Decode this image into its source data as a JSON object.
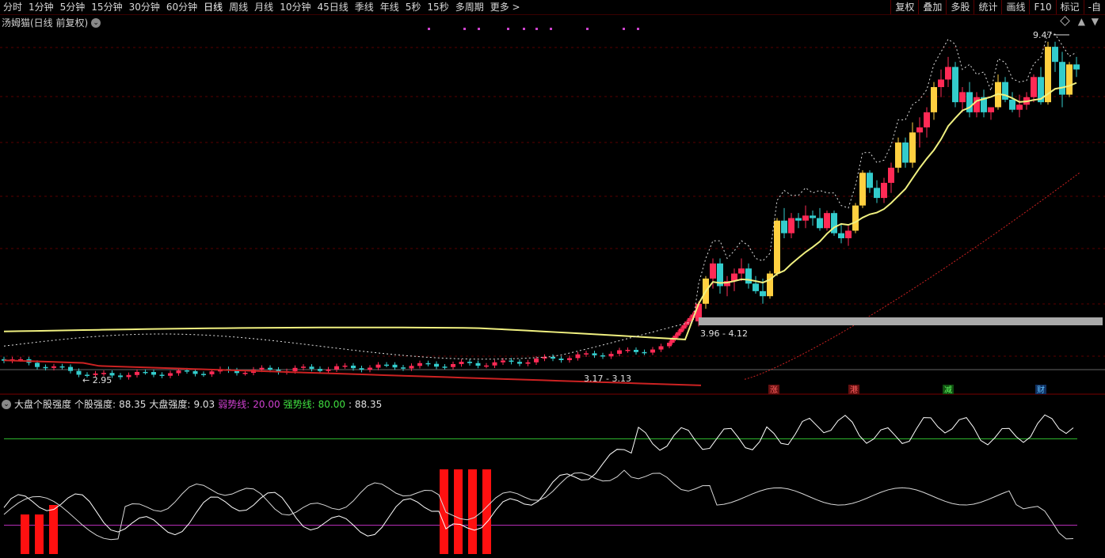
{
  "toolbar": {
    "periods": [
      "分时",
      "1分钟",
      "5分钟",
      "15分钟",
      "30分钟",
      "60分钟",
      "日线",
      "周线",
      "月线",
      "10分钟",
      "45日线",
      "季线",
      "年线",
      "5秒",
      "15秒",
      "多周期",
      "更多 >"
    ],
    "active_index": 6,
    "right_buttons": [
      "复权",
      "叠加",
      "多股",
      "统计",
      "画线",
      "F10",
      "标记",
      "-自"
    ]
  },
  "main_title": "汤姆猫(日线 前复权)",
  "price_labels": {
    "high": "9.47",
    "low_left": "2.95",
    "range_mid": "3.96 - 4.12",
    "range_low": "3.17 - 3.13"
  },
  "event_markers": [
    "涨",
    "港",
    "减",
    "财"
  ],
  "indicator": {
    "name": "大盘个股强度",
    "stock_label": "个股强度:",
    "stock_value": "88.35",
    "market_label": "大盘强度:",
    "market_value": "9.03",
    "weak_label": "弱势线:",
    "weak_value": "20.00",
    "strong_label": "强势线:",
    "strong_value": "80.00",
    "extra_value": ": 88.35"
  },
  "colors": {
    "up": "#ff2a55",
    "down": "#33cccc",
    "ma_yellow": "#f0f080",
    "dotted_white": "#e0e0e0",
    "red_line": "#cc2222",
    "grid": "#5a0000",
    "strong_line": "#30c030",
    "weak_line": "#c030c0",
    "signal_purple": "#cc44cc"
  },
  "chart_data": {
    "type": "candlestick",
    "price_range": [
      2.7,
      9.8
    ],
    "candles_late": [
      [
        4.05,
        4.45,
        3.95,
        4.4
      ],
      [
        4.4,
        4.95,
        4.3,
        4.9
      ],
      [
        4.9,
        5.3,
        4.7,
        5.2
      ],
      [
        5.2,
        5.3,
        4.6,
        4.75
      ],
      [
        4.75,
        4.95,
        4.55,
        4.85
      ],
      [
        4.85,
        5.1,
        4.65,
        5.0
      ],
      [
        5.0,
        5.3,
        4.85,
        5.1
      ],
      [
        5.1,
        5.2,
        4.7,
        4.8
      ],
      [
        4.8,
        4.95,
        4.6,
        4.65
      ],
      [
        4.65,
        4.9,
        4.4,
        4.55
      ],
      [
        4.55,
        5.05,
        4.5,
        5.0
      ],
      [
        5.0,
        6.1,
        4.95,
        6.05
      ],
      [
        6.05,
        6.3,
        5.7,
        5.8
      ],
      [
        5.8,
        6.2,
        5.7,
        6.1
      ],
      [
        6.1,
        6.2,
        5.9,
        6.05
      ],
      [
        6.05,
        6.35,
        5.9,
        6.15
      ],
      [
        6.15,
        6.25,
        5.95,
        6.1
      ],
      [
        6.1,
        6.3,
        5.85,
        5.9
      ],
      [
        5.9,
        6.25,
        5.85,
        6.2
      ],
      [
        6.2,
        6.25,
        5.75,
        5.8
      ],
      [
        5.8,
        6.0,
        5.6,
        5.7
      ],
      [
        5.7,
        5.95,
        5.55,
        5.85
      ],
      [
        5.85,
        6.4,
        5.8,
        6.35
      ],
      [
        6.35,
        7.05,
        6.3,
        7.0
      ],
      [
        7.0,
        7.05,
        6.6,
        6.7
      ],
      [
        6.7,
        6.85,
        6.4,
        6.5
      ],
      [
        6.5,
        6.9,
        6.4,
        6.8
      ],
      [
        6.8,
        7.2,
        6.6,
        7.1
      ],
      [
        7.1,
        7.7,
        7.0,
        7.6
      ],
      [
        7.6,
        7.7,
        7.1,
        7.2
      ],
      [
        7.2,
        8.0,
        7.1,
        7.8
      ],
      [
        7.8,
        8.1,
        7.5,
        7.9
      ],
      [
        7.9,
        8.3,
        7.7,
        8.2
      ],
      [
        8.2,
        8.8,
        8.05,
        8.7
      ],
      [
        8.7,
        9.05,
        8.5,
        8.85
      ],
      [
        8.85,
        9.3,
        8.7,
        9.1
      ],
      [
        9.1,
        9.2,
        8.3,
        8.4
      ],
      [
        8.4,
        8.7,
        8.2,
        8.6
      ],
      [
        8.6,
        8.8,
        8.1,
        8.2
      ],
      [
        8.2,
        8.6,
        8.1,
        8.5
      ],
      [
        8.5,
        8.65,
        8.1,
        8.2
      ],
      [
        8.2,
        8.3,
        8.05,
        8.3
      ],
      [
        8.3,
        8.95,
        8.25,
        8.8
      ],
      [
        8.8,
        8.9,
        8.4,
        8.45
      ],
      [
        8.45,
        8.6,
        8.2,
        8.25
      ],
      [
        8.25,
        8.55,
        8.1,
        8.35
      ],
      [
        8.35,
        8.6,
        8.25,
        8.5
      ],
      [
        8.5,
        8.95,
        8.4,
        8.9
      ],
      [
        8.9,
        9.1,
        8.35,
        8.4
      ],
      [
        8.4,
        9.6,
        8.35,
        9.5
      ],
      [
        9.5,
        9.6,
        9.0,
        9.2
      ],
      [
        9.2,
        9.4,
        8.3,
        8.55
      ],
      [
        8.55,
        9.2,
        8.5,
        9.15
      ],
      [
        9.15,
        9.3,
        8.9,
        9.05
      ]
    ]
  }
}
